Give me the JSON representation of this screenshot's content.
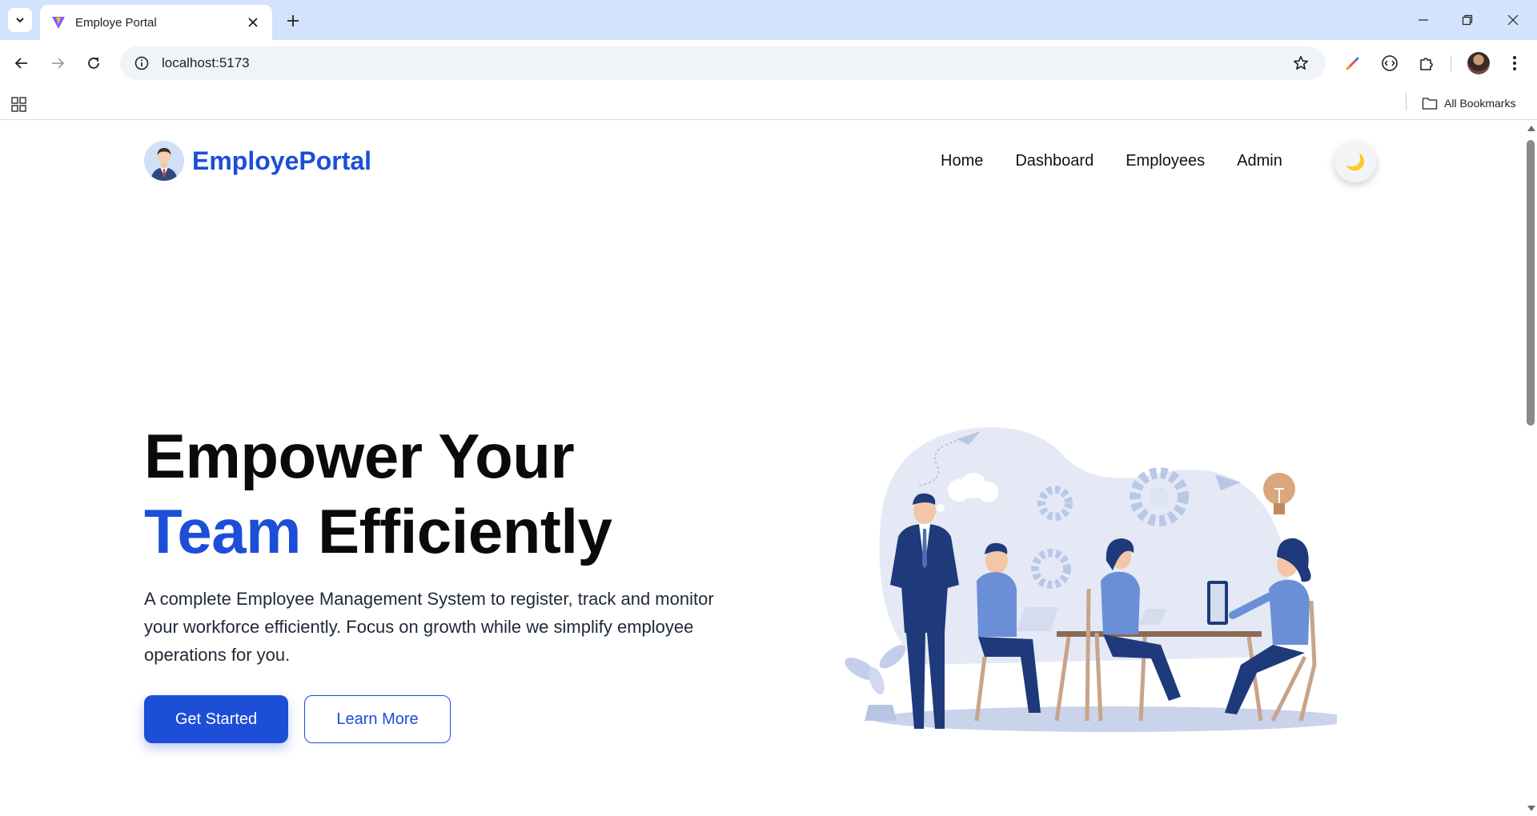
{
  "browser": {
    "tab_title": "Employe Portal",
    "url": "localhost:5173",
    "bookmarks_label": "All Bookmarks",
    "icons": {
      "tab_search": "chevron-down-icon",
      "favicon": "vite-icon",
      "close": "close-icon",
      "new_tab": "plus-icon",
      "back": "arrow-left-icon",
      "forward": "arrow-right-icon",
      "reload": "reload-icon",
      "site_info": "info-icon",
      "bookmark_star": "star-icon",
      "extensions": "puzzle-icon",
      "menu": "kebab-menu-icon"
    }
  },
  "navbar": {
    "brand": "EmployePortal",
    "links": [
      "Home",
      "Dashboard",
      "Employees",
      "Admin"
    ],
    "theme_toggle": "🌙"
  },
  "hero": {
    "title_line1": "Empower Your",
    "title_accent": "Team",
    "title_rest": "Efficiently",
    "description": "A complete Employee Management System to register, track and monitor your workforce efficiently. Focus on growth while we simplify employee operations for you.",
    "primary_button": "Get Started",
    "secondary_button": "Learn More"
  },
  "colors": {
    "accent": "#1d4ed8",
    "chrome_tabbar": "#d3e3fd",
    "illustration_blob": "#e4e9f5",
    "illustration_navy": "#1e3a7b",
    "illustration_light_blue": "#6b8fd6"
  }
}
